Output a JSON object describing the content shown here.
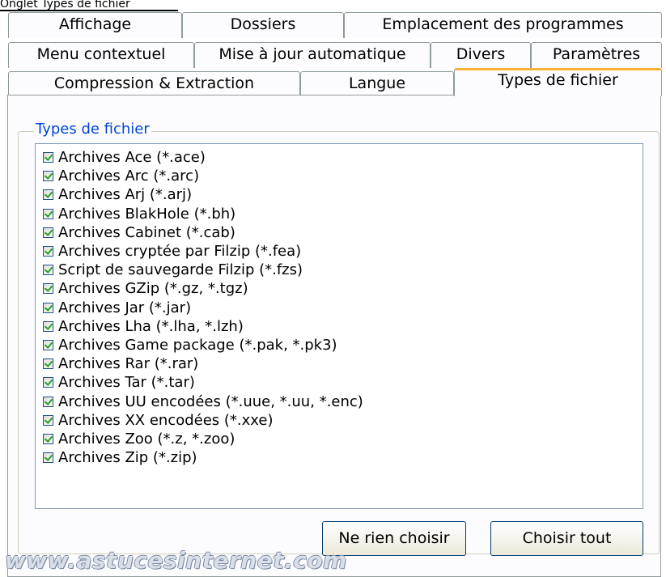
{
  "header": {
    "partial_text": "Onglet Types de fichier"
  },
  "tabs": {
    "row1": [
      "Affichage",
      "Dossiers",
      "Emplacement des programmes"
    ],
    "row2": [
      "Menu contextuel",
      "Mise à jour automatique",
      "Divers",
      "Paramètres"
    ],
    "row3": [
      "Compression & Extraction",
      "Langue",
      "Types de fichier"
    ]
  },
  "active_tab": "Types de fichier",
  "group": {
    "title": "Types de fichier",
    "items": [
      {
        "label": "Archives Ace  (*.ace)",
        "checked": true
      },
      {
        "label": "Archives Arc  (*.arc)",
        "checked": true
      },
      {
        "label": "Archives Arj  (*.arj)",
        "checked": true
      },
      {
        "label": "Archives BlakHole  (*.bh)",
        "checked": true
      },
      {
        "label": "Archives Cabinet  (*.cab)",
        "checked": true
      },
      {
        "label": "Archives cryptée par Filzip (*.fea)",
        "checked": true
      },
      {
        "label": "Script de sauvegarde Filzip (*.fzs)",
        "checked": true
      },
      {
        "label": "Archives GZip  (*.gz, *.tgz)",
        "checked": true
      },
      {
        "label": "Archives Jar  (*.jar)",
        "checked": true
      },
      {
        "label": "Archives Lha  (*.lha, *.lzh)",
        "checked": true
      },
      {
        "label": "Archives Game package  (*.pak, *.pk3)",
        "checked": true
      },
      {
        "label": "Archives Rar  (*.rar)",
        "checked": true
      },
      {
        "label": "Archives Tar (*.tar)",
        "checked": true
      },
      {
        "label": "Archives UU encodées  (*.uue, *.uu, *.enc)",
        "checked": true
      },
      {
        "label": "Archives XX encodées (*.xxe)",
        "checked": true
      },
      {
        "label": "Archives Zoo  (*.z, *.zoo)",
        "checked": true
      },
      {
        "label": "Archives Zip  (*.zip)",
        "checked": true
      }
    ]
  },
  "buttons": {
    "select_none": "Ne rien choisir",
    "select_all": "Choisir tout"
  },
  "watermark": "www.astucesinternet.com",
  "colors": {
    "active_tab_accent": "#f6b13b",
    "group_title": "#0046d5",
    "check": "#21a121"
  }
}
